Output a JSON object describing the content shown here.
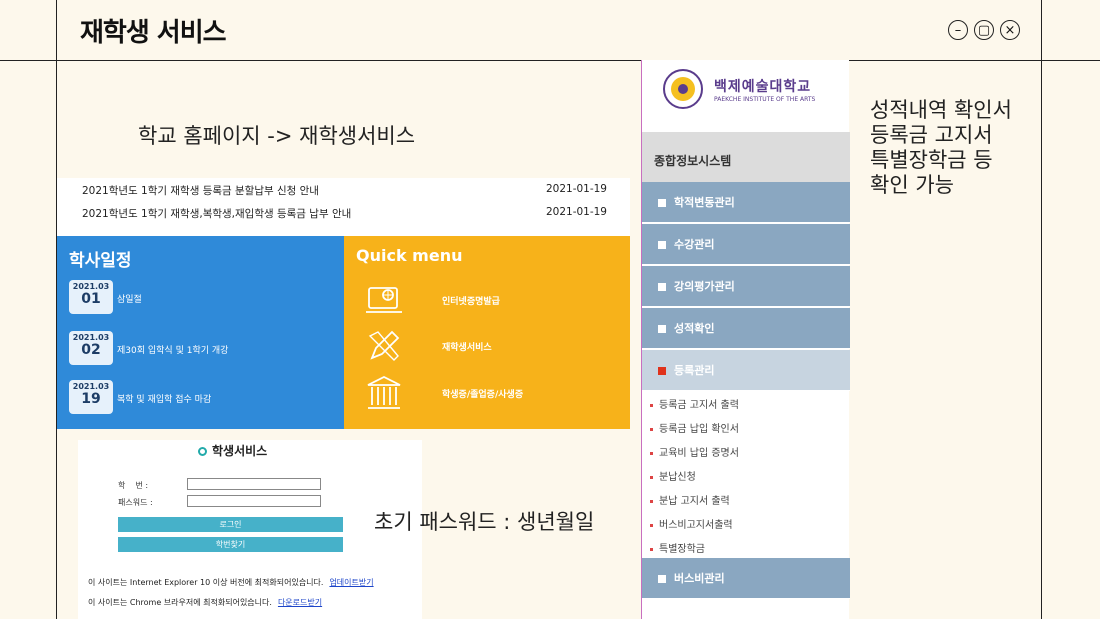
{
  "window": {
    "title": "재학생 서비스",
    "buttons": [
      "minimize",
      "restore",
      "close"
    ]
  },
  "notes": {
    "path": "학교 홈페이지 -> 재학생서비스",
    "password": "초기 패스워드 : 생년월일",
    "right": [
      "성적내역 확인서",
      "등록금 고지서",
      "특별장학금 등",
      "확인 가능"
    ]
  },
  "notices": [
    {
      "title": "2021학년도 1학기 재학생 등록금 분할납부 신청 안내",
      "date": "2021-01-19"
    },
    {
      "title": "2021학년도 1학기 재학생,복학생,재입학생 등록금 납부 안내",
      "date": "2021-01-19"
    }
  ],
  "schedule": {
    "title": "학사일정",
    "items": [
      {
        "ym": "2021.03",
        "day": "01",
        "text": "삼일절"
      },
      {
        "ym": "2021.03",
        "day": "02",
        "text": "제30회 입학식 및 1학기 개강"
      },
      {
        "ym": "2021.03",
        "day": "19",
        "text": "복학 및 재입학 접수 마감"
      }
    ]
  },
  "quick_menu": {
    "title": "Quick menu",
    "items": [
      {
        "label": "인터넷증명발급",
        "icon": "certificate-icon"
      },
      {
        "label": "재학생서비스",
        "icon": "pencil-icon"
      },
      {
        "label": "학생증/졸업증/사생증",
        "icon": "building-icon"
      }
    ]
  },
  "login": {
    "title": "학생서비스",
    "id_label": "학    번 :",
    "pw_label": "패스워드 :",
    "login_button": "로그인",
    "find_button": "학번찾기",
    "notes": [
      {
        "text": "이 사이트는 Internet Explorer 10 이상 버전에 최적화되어있습니다.",
        "link": "업데이트받기"
      },
      {
        "text": "이 사이트는 Chrome 브라우저에 최적화되어있습니다.",
        "link": "다운로드받기"
      }
    ]
  },
  "nav": {
    "school_name": "백제예술대학교",
    "school_name_en": "PAEKCHE INSTITUTE OF THE ARTS",
    "header": "종합정보시스템",
    "items": [
      "학적변동관리",
      "수강관리",
      "강의평가관리",
      "성적확인"
    ],
    "open_item": "등록관리",
    "sub_items": [
      "등록금 고지서 출력",
      "등록금 납입 확인서",
      "교육비 납입 증명서",
      "분납신청",
      "분납 고지서 출력",
      "버스비고지서출력",
      "특별장학금"
    ],
    "last_item": "버스비관리"
  },
  "colors": {
    "schedule_bg": "#2f8ad9",
    "quick_bg": "#f7b21a",
    "nav_item_bg": "#8aa7c1",
    "login_btn": "#46b1c9"
  }
}
